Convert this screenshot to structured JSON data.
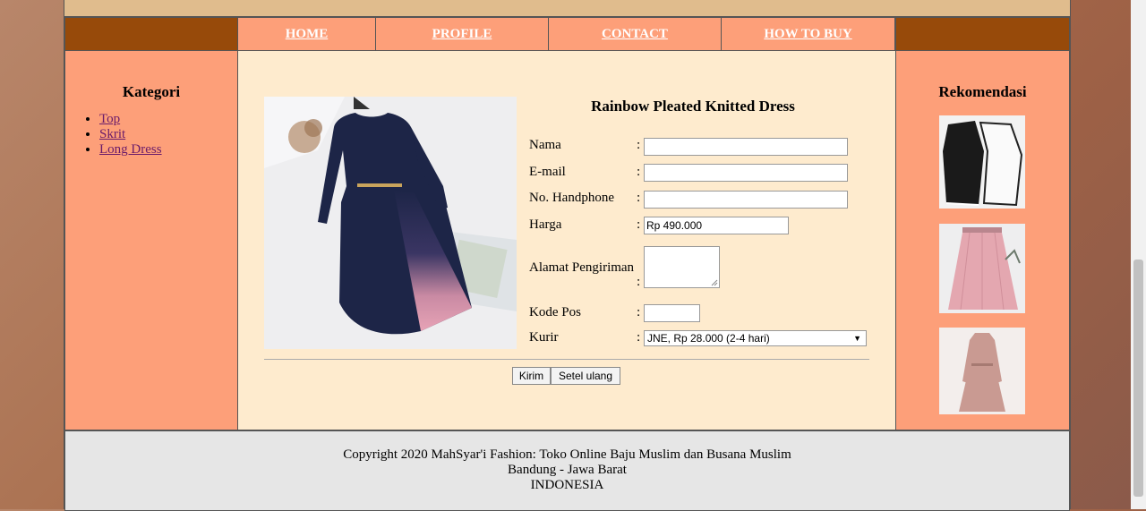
{
  "nav": {
    "items": [
      "HOME",
      "PROFILE",
      "CONTACT",
      "HOW TO BUY"
    ]
  },
  "sidebar": {
    "title": "Kategori",
    "items": [
      "Top",
      "Skrit",
      "Long Dress"
    ]
  },
  "product": {
    "title": "Rainbow Pleated Knitted Dress"
  },
  "form": {
    "labels": {
      "nama": "Nama",
      "email": "E-mail",
      "hp": "No. Handphone",
      "harga": "Harga",
      "alamat": "Alamat Pengiriman",
      "kodepos": "Kode Pos",
      "kurir": "Kurir"
    },
    "colon": ":",
    "harga_value": "Rp 490.000",
    "kurir_selected": "JNE, Rp 28.000 (2-4 hari)",
    "submit_label": "Kirim",
    "reset_label": "Setel ulang"
  },
  "recommend": {
    "title": "Rekomendasi"
  },
  "footer": {
    "line1": "Copyright 2020 MahSyar'i Fashion: Toko Online Baju Muslim dan Busana Muslim",
    "line2": "Bandung - Jawa Barat",
    "line3": "INDONESIA"
  }
}
